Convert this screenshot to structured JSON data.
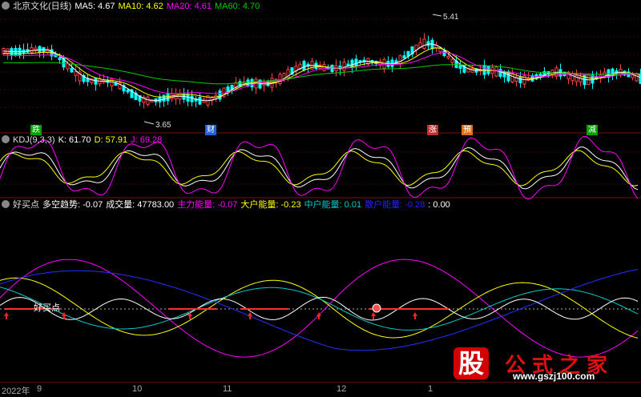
{
  "price_panel": {
    "gear_icon": "gear-icon",
    "title": "北京文化(日线)",
    "ma": [
      {
        "label": "MA5: 4.67",
        "color": "#ffffff"
      },
      {
        "label": "MA10: 4.62",
        "color": "#ffff00"
      },
      {
        "label": "MA20: 4.61",
        "color": "#ff00ff"
      },
      {
        "label": "MA60: 4.70",
        "color": "#00cc00"
      }
    ],
    "high_label": "5.41",
    "low_label": "3.65",
    "markers": [
      {
        "text": "跌",
        "color": "#00c000"
      },
      {
        "text": "财",
        "color": "#3070ff"
      },
      {
        "text": "涨",
        "color": "#e04040"
      },
      {
        "text": "預",
        "color": "#ff8c1a"
      },
      {
        "text": "减",
        "color": "#00c000"
      }
    ]
  },
  "kdj_panel": {
    "gear_icon": "gear-icon",
    "title": "KDJ(9,3,3)",
    "items": [
      {
        "label": "K: 61.70",
        "color": "#ffffff"
      },
      {
        "label": "D: 57.91",
        "color": "#ffff00"
      },
      {
        "label": "J: 69.28",
        "color": "#ff00ff"
      }
    ]
  },
  "indicator_panel": {
    "gear_icon": "gear-icon",
    "title": "好买点",
    "items": [
      {
        "label": "多空趋势: -0.07",
        "color": "#ffffff"
      },
      {
        "label": "成交量: 47783.00",
        "color": "#ffffff"
      },
      {
        "label": "主力能量: -0.07",
        "color": "#ff00ff"
      },
      {
        "label": "大户能量: -0.23",
        "color": "#ffff00"
      },
      {
        "label": "中户能量: 0.01",
        "color": "#00cccc"
      },
      {
        "label": "散户能量: -0.28",
        "color": "#0000ff"
      },
      {
        "label": ": 0.00",
        "color": "#ffffff"
      }
    ],
    "buy_label": "好买点"
  },
  "time_axis": {
    "labels": [
      "2022年",
      "9",
      "10",
      "11",
      "12",
      "1"
    ]
  },
  "watermark": {
    "glyph": "股",
    "text": "公式之家",
    "url": "www.gszj100.com"
  }
}
